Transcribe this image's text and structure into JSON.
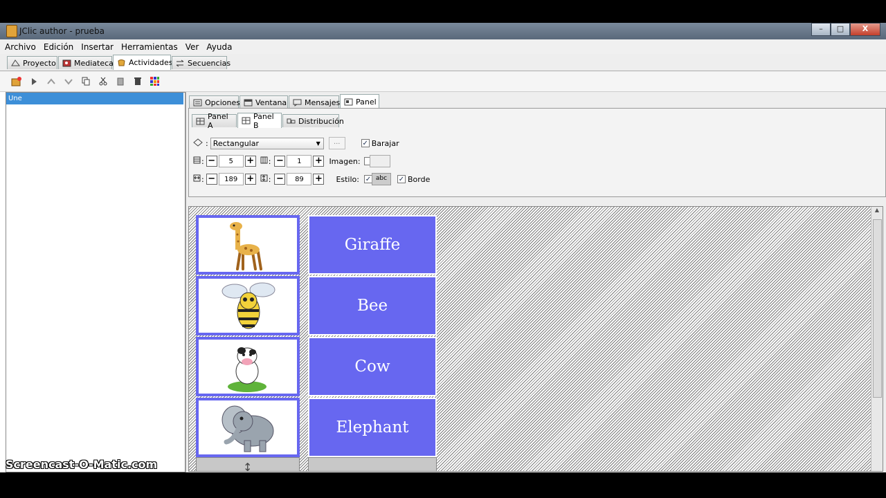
{
  "window": {
    "title": "JClic author - prueba",
    "min": "–",
    "max": "□",
    "close": "X"
  },
  "menu": [
    "Archivo",
    "Edición",
    "Insertar",
    "Herramientas",
    "Ver",
    "Ayuda"
  ],
  "main_tabs": [
    "Proyecto",
    "Mediateca",
    "Actividades",
    "Secuencias"
  ],
  "activity_list": {
    "selected": "Une"
  },
  "sub_tabs": [
    "Opciones",
    "Ventana",
    "Mensajes",
    "Panel"
  ],
  "panel_tabs": [
    "Panel A",
    "Panel B",
    "Distribución"
  ],
  "controls": {
    "shape_select": "Rectangular",
    "ellipsis": "...",
    "shuffle_label": "Barajar",
    "rows": "5",
    "cols": "1",
    "image_label": "Imagen:",
    "width": "189",
    "height": "89",
    "style_label": "Estilo:",
    "style_sample": "abc",
    "border_label": "Borde"
  },
  "cells_text": [
    "Giraffe",
    "Bee",
    "Cow",
    "Elephant"
  ],
  "cells_images": [
    "giraffe",
    "bee",
    "cow",
    "elephant"
  ],
  "colors": {
    "cell_fill": "#6767f0",
    "selection": "#3d8fd8"
  },
  "watermark": "Screencast-O-Matic.com"
}
